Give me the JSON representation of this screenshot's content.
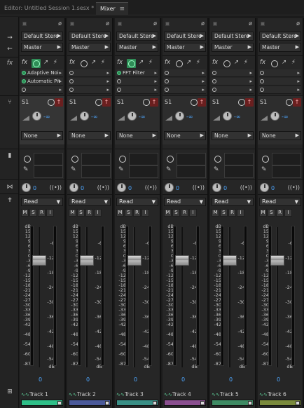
{
  "tabs": {
    "editor": "Editor: Untitled Session 1.sesx *",
    "mixer": "Mixer",
    "menu": "≡"
  },
  "sidebar": {
    "in": "→",
    "out": "←",
    "fx": "fx",
    "sends": "⑂",
    "eq": "▮",
    "pan": "⋈",
    "auto": "✝",
    "names": "⊞"
  },
  "labels": {
    "input": "Default Stere",
    "output": "Master",
    "send_id": "S1",
    "send_dest": "None",
    "send_val": "-∞",
    "pan_val": "0",
    "read_mode": "Read",
    "vol_val": "0",
    "m": "M",
    "s": "S",
    "r": "R",
    "i": "I",
    "db": "dB"
  },
  "db_scale": [
    "dB",
    "15",
    "12",
    "9",
    "6",
    "3",
    "0",
    "-3",
    "-6",
    "-9",
    "-12",
    "-15",
    "-18",
    "-21",
    "-24",
    "-27",
    "-30",
    "-33",
    "-36",
    "-39",
    "-42",
    "-48",
    "-54",
    "-60",
    "-87"
  ],
  "meter_ticks": [
    "-6",
    "-12",
    "-18",
    "-24",
    "-30",
    "-36",
    "-42",
    "-48",
    "-54",
    "dB"
  ],
  "tracks": [
    {
      "name": "Track 1",
      "color": "#2fbf88",
      "fx": [
        "Adaptive Noi",
        "Automatic Pit"
      ],
      "fx_on": true
    },
    {
      "name": "Track 2",
      "color": "#4b5a9a",
      "fx": [
        "",
        ""
      ],
      "fx_on": false
    },
    {
      "name": "Track 3",
      "color": "#3a8f86",
      "fx": [
        "FFT Filter",
        ""
      ],
      "fx_on": true
    },
    {
      "name": "Track 4",
      "color": "#8a4f8f",
      "fx": [
        "",
        ""
      ],
      "fx_on": false
    },
    {
      "name": "Track 5",
      "color": "#3e8a63",
      "fx": [
        "",
        ""
      ],
      "fx_on": false
    },
    {
      "name": "Track 6",
      "color": "#7a8a3c",
      "fx": [
        "",
        ""
      ],
      "fx_on": false
    }
  ]
}
